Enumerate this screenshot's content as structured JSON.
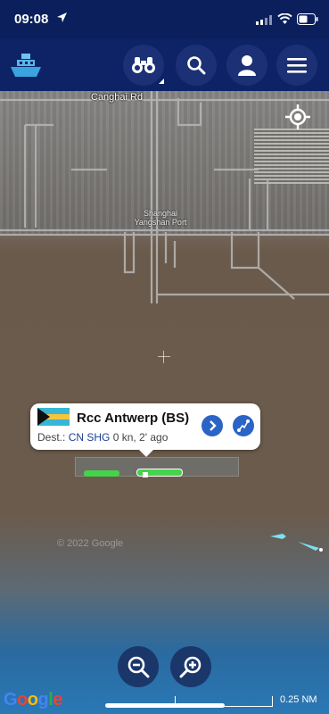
{
  "status_bar": {
    "time": "09:08"
  },
  "app": {
    "logo_icon": "ship-logo-icon"
  },
  "toolbar": {
    "buttons": [
      "binoculars-icon",
      "search-icon",
      "user-icon",
      "menu-icon"
    ]
  },
  "map": {
    "street_label": "Canghai Rd",
    "port_label_line1": "Shanghai",
    "port_label_line2": "Yangshan Port",
    "watermark": "© 2022 Google",
    "scale_label": "0.25 NM",
    "google_logo": "Google"
  },
  "popup": {
    "vessel_name": "Rcc Antwerp (BS)",
    "dest_prefix": "Dest.:",
    "dest_code": "CN SHG",
    "speed_time": "0 kn, 2' ago",
    "flag_colors": {
      "black": "#111111",
      "aqua": "#37b6d6",
      "gold": "#f5c53d"
    }
  },
  "colors": {
    "bar": "#0d2366",
    "status": "#0a1f5c",
    "ship_green": "#44d34a",
    "accent_blue": "#2a64c6"
  }
}
